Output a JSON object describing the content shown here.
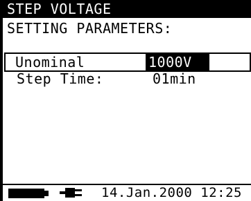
{
  "header": {
    "title": "STEP VOLTAGE",
    "subtitle": "SETTING PARAMETERS:"
  },
  "parameters": [
    {
      "label": "Unominal",
      "value": "1000V",
      "selected": true
    },
    {
      "label": "Step Time:",
      "value": "01min",
      "selected": false
    }
  ],
  "status": {
    "battery_icon": "battery-full-icon",
    "power_icon": "mains-plug-icon",
    "datetime": "14.Jan.2000 12:25"
  },
  "colors": {
    "background": "#ffffff",
    "foreground": "#000000",
    "highlight_bg": "#000000",
    "highlight_fg": "#ffffff"
  }
}
